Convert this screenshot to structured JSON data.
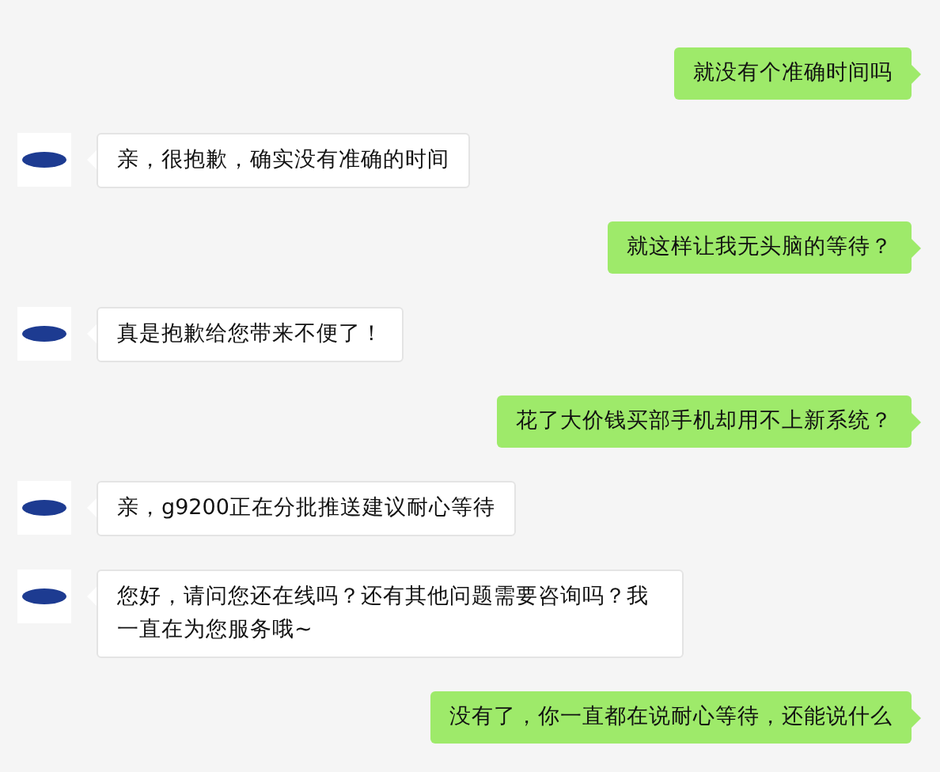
{
  "messages": [
    {
      "kind": "sent",
      "text": "就没有个准确时间吗"
    },
    {
      "kind": "received",
      "text": "亲，很抱歉，确实没有准确的时间"
    },
    {
      "kind": "sent",
      "text": "就这样让我无头脑的等待？"
    },
    {
      "kind": "received",
      "text": "真是抱歉给您带来不便了！"
    },
    {
      "kind": "sent",
      "text": "花了大价钱买部手机却用不上新系统？"
    },
    {
      "kind": "received",
      "text": "亲，g9200正在分批推送建议耐心等待"
    },
    {
      "kind": "received",
      "text": "您好，请问您还在线吗？还有其他问题需要咨询吗？我一直在为您服务哦~"
    },
    {
      "kind": "sent",
      "text": "没有了，你一直都在说耐心等待，还能说什么"
    }
  ]
}
